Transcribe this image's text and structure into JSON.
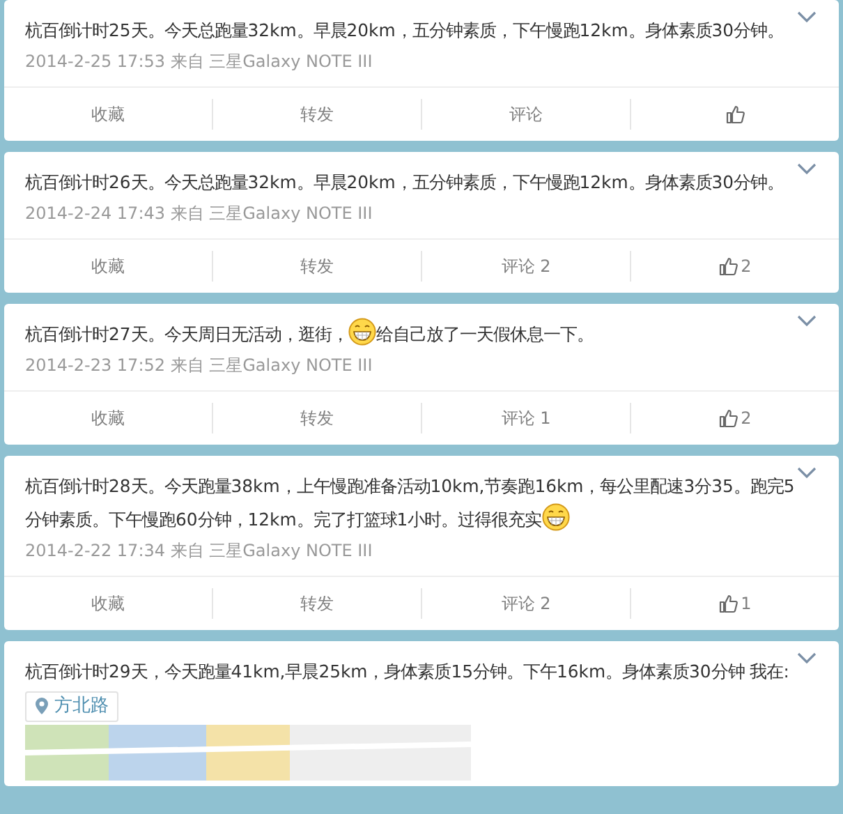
{
  "posts": [
    {
      "segments": [
        {
          "kind": "text",
          "text": "杭百倒计时25天。今天总跑量32km。早晨20km，五分钟素质，下午慢跑12km。身体素质30分钟。"
        }
      ],
      "meta": "2014-2-25 17:53 来自 三星Galaxy NOTE III",
      "actions": {
        "favorite": "收藏",
        "repost": "转发",
        "comment": "评论"
      }
    },
    {
      "segments": [
        {
          "kind": "text",
          "text": "杭百倒计时26天。今天总跑量32km。早晨20km，五分钟素质，下午慢跑12km。身体素质30分钟。"
        }
      ],
      "meta": "2014-2-24 17:43 来自 三星Galaxy NOTE III",
      "actions": {
        "favorite": "收藏",
        "repost": "转发",
        "comment": "评论 2",
        "like": "2"
      }
    },
    {
      "segments": [
        {
          "kind": "text",
          "text": "杭百倒计时27天。今天周日无活动，逛街，"
        },
        {
          "kind": "emoji"
        },
        {
          "kind": "text",
          "text": "给自己放了一天假休息一下。"
        }
      ],
      "meta": "2014-2-23 17:52 来自 三星Galaxy NOTE III",
      "actions": {
        "favorite": "收藏",
        "repost": "转发",
        "comment": "评论 1",
        "like": "2"
      }
    },
    {
      "segments": [
        {
          "kind": "text",
          "text": "杭百倒计时28天。今天跑量38km，上午慢跑准备活动10km,节奏跑16km，每公里配速3分35。跑完5分钟素质。下午慢跑60分钟，12km。完了打篮球1小时。过得很充实"
        },
        {
          "kind": "emoji"
        }
      ],
      "meta": "2014-2-22 17:34 来自 三星Galaxy NOTE III",
      "actions": {
        "favorite": "收藏",
        "repost": "转发",
        "comment": "评论 2",
        "like": "1"
      }
    },
    {
      "segments": [
        {
          "kind": "text",
          "text": "杭百倒计时29天，今天跑量41km,早晨25km，身体素质15分钟。下午16km。身体素质30分钟 我在:"
        },
        {
          "kind": "location",
          "text": "方北路"
        }
      ],
      "media": {
        "kind": "picture"
      }
    }
  ]
}
